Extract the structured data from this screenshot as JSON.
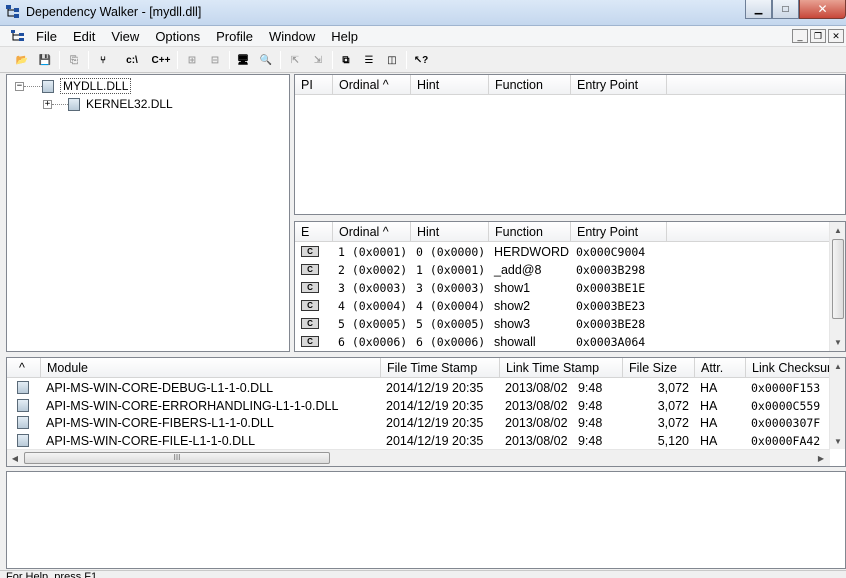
{
  "window": {
    "title": "Dependency Walker - [mydll.dll]",
    "minimize": "▁",
    "maximize": "□",
    "close": "✕"
  },
  "menu": [
    {
      "label": "File"
    },
    {
      "label": "Edit"
    },
    {
      "label": "View"
    },
    {
      "label": "Options"
    },
    {
      "label": "Profile"
    },
    {
      "label": "Window"
    },
    {
      "label": "Help"
    }
  ],
  "mdi": {
    "minimize": "_",
    "restore": "❐",
    "close": "✕"
  },
  "toolbar": {
    "items": [
      {
        "name": "open-icon",
        "glyph": "📂"
      },
      {
        "name": "save-icon",
        "glyph": "💾"
      },
      {
        "name": "copy-icon",
        "glyph": "⎘",
        "disabled": true
      },
      {
        "name": "full-paths-icon",
        "glyph": "⑂"
      },
      {
        "name": "path-icon",
        "glyph": "c:\\"
      },
      {
        "name": "undecorate-cpp-icon",
        "glyph": "C++"
      },
      {
        "name": "ordinal-icon",
        "glyph": "⊞",
        "disabled": true
      },
      {
        "name": "properties-icon",
        "glyph": "⊟",
        "disabled": true
      },
      {
        "name": "system-info-icon",
        "glyph": "🖥"
      },
      {
        "name": "find-icon",
        "glyph": "🔍"
      },
      {
        "name": "highlight-matching-icon",
        "glyph": "⇱",
        "disabled": true
      },
      {
        "name": "goto-module-icon",
        "glyph": "⇲",
        "disabled": true
      },
      {
        "name": "cascade-icon",
        "glyph": "⧉"
      },
      {
        "name": "tile-horizontal-icon",
        "glyph": "☰"
      },
      {
        "name": "tile-vertical-icon",
        "glyph": "◫"
      },
      {
        "name": "context-help-icon",
        "glyph": "↖?"
      }
    ]
  },
  "tree": {
    "root": {
      "label": "MYDLL.DLL",
      "expander": "−"
    },
    "child": {
      "label": "KERNEL32.DLL",
      "expander": "+"
    }
  },
  "parent_imports": {
    "headers": [
      "PI",
      "Ordinal ^",
      "Hint",
      "Function",
      "Entry Point"
    ]
  },
  "exports": {
    "headers": [
      "E",
      "Ordinal ^",
      "Hint",
      "Function",
      "Entry Point"
    ],
    "type_label": "C",
    "rows": [
      {
        "ordinal": "1 (0x0001)",
        "hint": "0 (0x0000)",
        "function": "HERDWORD",
        "entry": "0x000C9004"
      },
      {
        "ordinal": "2 (0x0002)",
        "hint": "1 (0x0001)",
        "function": "_add@8",
        "entry": "0x0003B298"
      },
      {
        "ordinal": "3 (0x0003)",
        "hint": "3 (0x0003)",
        "function": "show1",
        "entry": "0x0003BE1E"
      },
      {
        "ordinal": "4 (0x0004)",
        "hint": "4 (0x0004)",
        "function": "show2",
        "entry": "0x0003BE23"
      },
      {
        "ordinal": "5 (0x0005)",
        "hint": "5 (0x0005)",
        "function": "show3",
        "entry": "0x0003BE28"
      },
      {
        "ordinal": "6 (0x0006)",
        "hint": "6 (0x0006)",
        "function": "showall",
        "entry": "0x0003A064"
      }
    ]
  },
  "modules": {
    "headers": [
      "^",
      "Module",
      "File Time Stamp",
      "Link Time Stamp",
      "File Size",
      "Attr.",
      "Link Checksum"
    ],
    "rows": [
      {
        "module": "API-MS-WIN-CORE-DEBUG-L1-1-0.DLL",
        "file_ts": "2014/12/19 20:35",
        "link_ts": "2013/08/02   9:48",
        "size": "3,072",
        "attr": "HA",
        "checksum": "0x0000F153"
      },
      {
        "module": "API-MS-WIN-CORE-ERRORHANDLING-L1-1-0.DLL",
        "file_ts": "2014/12/19 20:35",
        "link_ts": "2013/08/02   9:48",
        "size": "3,072",
        "attr": "HA",
        "checksum": "0x0000C559"
      },
      {
        "module": "API-MS-WIN-CORE-FIBERS-L1-1-0.DLL",
        "file_ts": "2014/12/19 20:35",
        "link_ts": "2013/08/02   9:48",
        "size": "3,072",
        "attr": "HA",
        "checksum": "0x0000307F"
      },
      {
        "module": "API-MS-WIN-CORE-FILE-L1-1-0.DLL",
        "file_ts": "2014/12/19 20:35",
        "link_ts": "2013/08/02   9:48",
        "size": "5,120",
        "attr": "HA",
        "checksum": "0x0000FA42"
      }
    ]
  },
  "scroll": {
    "up": "▲",
    "down": "▼",
    "left": "◀",
    "right": "▶",
    "grip": "III"
  },
  "status": {
    "text": "For Help, press F1"
  }
}
